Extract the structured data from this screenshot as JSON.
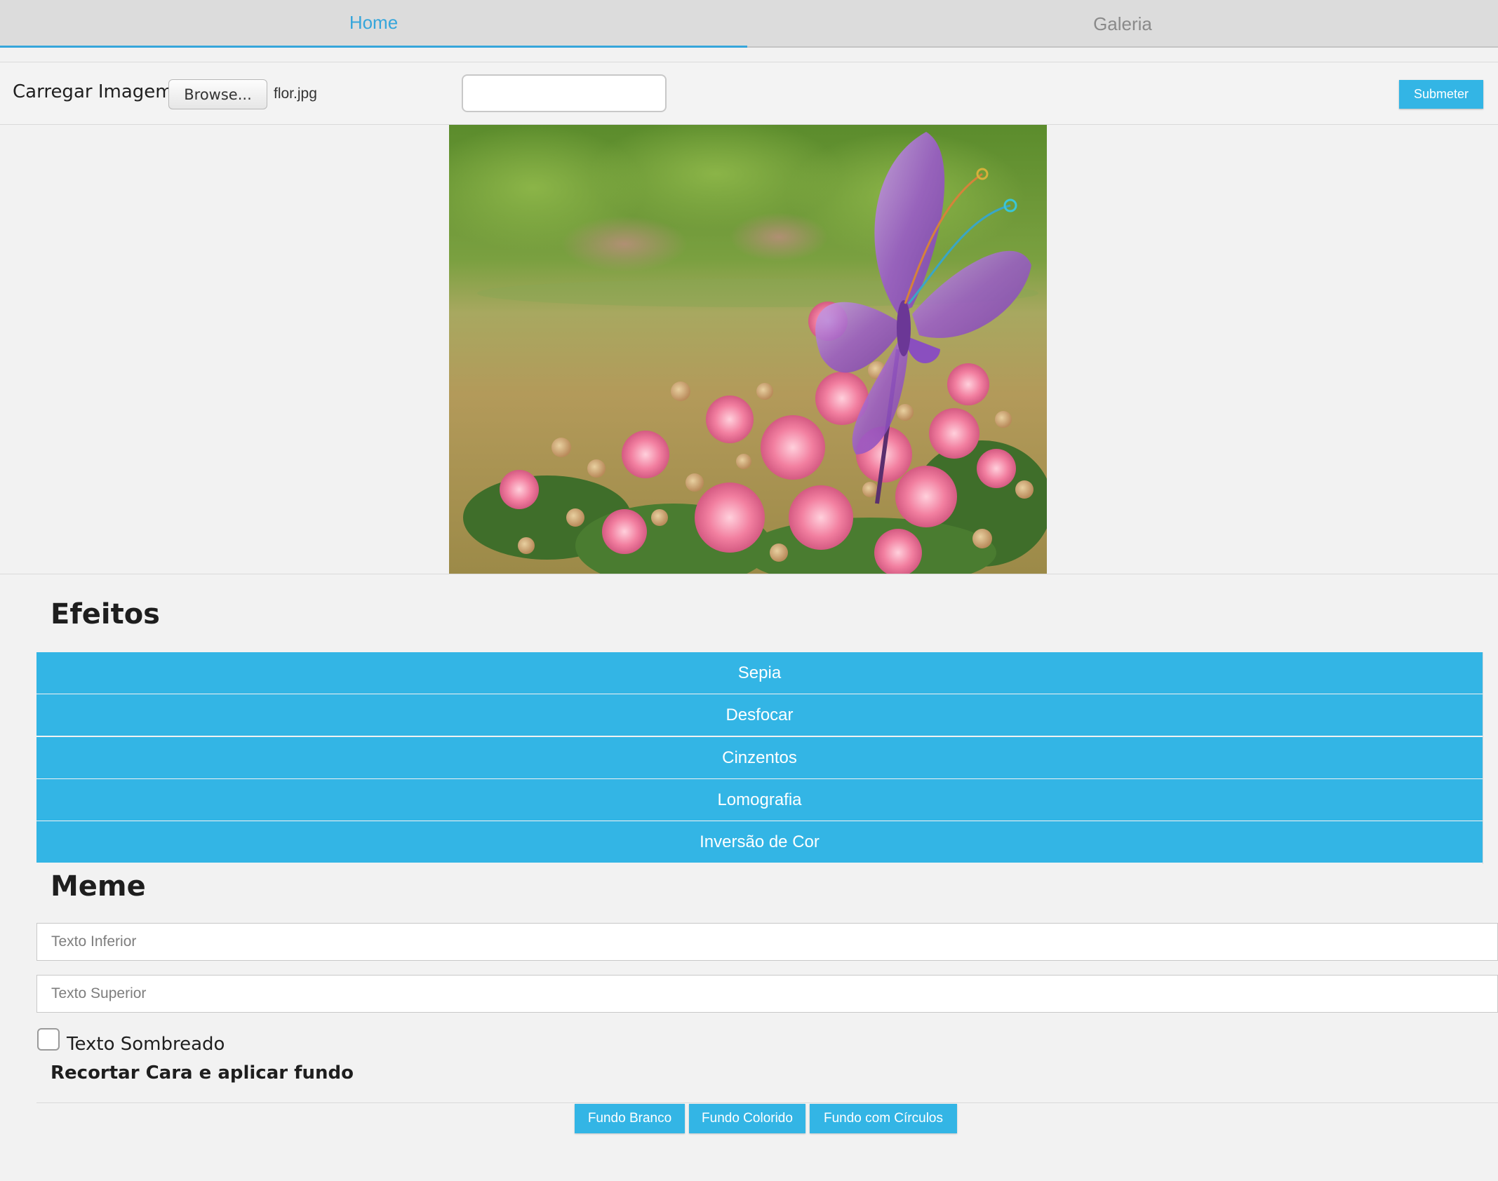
{
  "tabs": {
    "home": "Home",
    "galeria": "Galeria"
  },
  "upload": {
    "label": "Carregar Imagem",
    "browse_label": "Browse...",
    "filename": "flor.jpg",
    "text_value": "",
    "submit_label": "Submeter"
  },
  "efeitos": {
    "heading": "Efeitos",
    "buttons": [
      "Sepia",
      "Desfocar",
      "Cinzentos",
      "Lomografia",
      "Inversão de Cor"
    ]
  },
  "meme": {
    "heading": "Meme",
    "input_inferior_placeholder": "Texto Inferior",
    "input_superior_placeholder": "Texto Superior",
    "checkbox_label": "Texto Sombreado",
    "checkbox_checked": false
  },
  "recortar": {
    "heading": "Recortar Cara e aplicar fundo",
    "buttons": [
      "Fundo Branco",
      "Fundo Colorido",
      "Fundo com Círculos"
    ]
  },
  "colors": {
    "accent": "#33b5e5",
    "tab_active": "#36a6db",
    "background": "#f2f2f2"
  }
}
